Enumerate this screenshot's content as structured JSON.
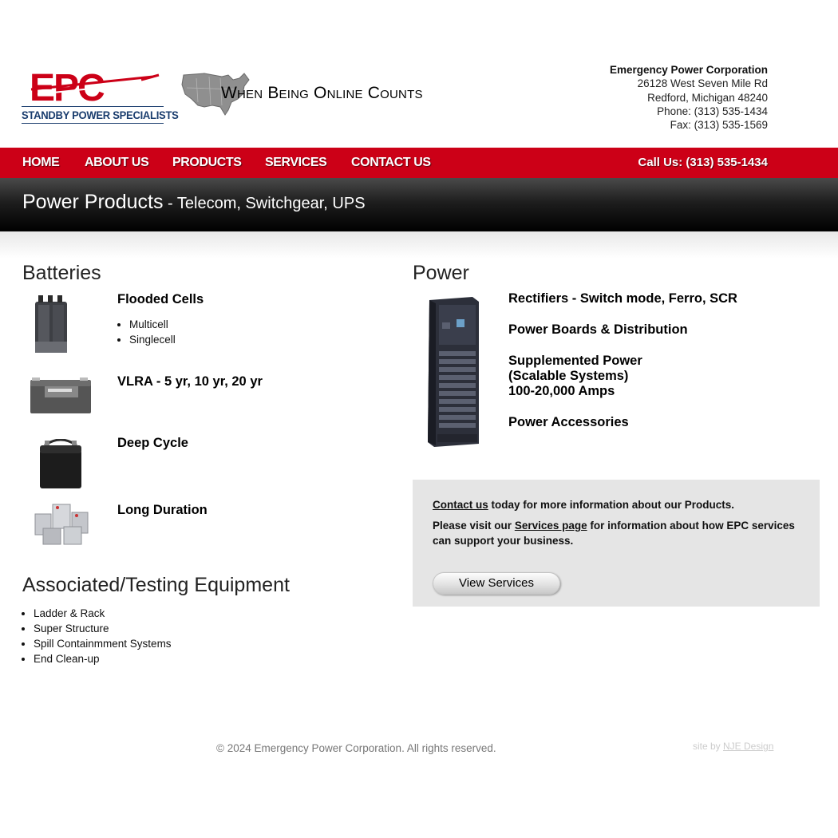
{
  "brand": {
    "logo_text": "EPC",
    "tagline": "STANDBY POWER SPECIALISTS",
    "slogan": "When Being Online Counts",
    "colors": {
      "red": "#cc0017",
      "navy": "#1a3d6e",
      "banner_dark": "#000000"
    }
  },
  "company": {
    "name": "Emergency Power Corporation",
    "street": "26128 West Seven Mile Rd",
    "city": "Redford, Michigan 48240",
    "phone": "Phone: (313) 535-1434",
    "fax": "Fax: (313) 535-1569"
  },
  "nav": {
    "items": [
      {
        "label": "HOME"
      },
      {
        "label": "ABOUT US"
      },
      {
        "label": "PRODUCTS"
      },
      {
        "label": "SERVICES"
      },
      {
        "label": "CONTACT US"
      }
    ],
    "call_us": "Call Us: (313) 535-1434"
  },
  "banner": {
    "title": "Power Products",
    "subtitle": " - Telecom, Switchgear, UPS"
  },
  "batteries": {
    "heading": "Batteries",
    "products": [
      {
        "title": "Flooded Cells",
        "bullets": [
          "Multicell",
          "Singlecell"
        ],
        "image_icon": "flooded-cell-battery-icon"
      },
      {
        "title": "VLRA - 5 yr, 10 yr, 20 yr",
        "image_icon": "vrla-battery-icon"
      },
      {
        "title": "Deep Cycle",
        "image_icon": "deep-cycle-battery-icon"
      },
      {
        "title": "Long Duration",
        "image_icon": "long-duration-battery-icon"
      }
    ]
  },
  "associated": {
    "heading": "Associated/Testing Equipment",
    "items": [
      "Ladder & Rack",
      "Super Structure",
      "Spill Containmment Systems",
      "End Clean-up"
    ]
  },
  "power": {
    "heading": "Power",
    "image_icon": "power-rack-cabinet-icon",
    "items": [
      "Rectifiers - Switch mode, Ferro, SCR",
      "Power Boards & Distribution",
      "Supplemented Power",
      "(Scalable Systems)",
      "100-20,000 Amps",
      "Power Accessories"
    ]
  },
  "info_box": {
    "contact_link": "Contact us",
    "contact_rest": " today for more information about our Products.",
    "services_pre": "Please visit our ",
    "services_link": "Services page",
    "services_rest": " for information about how EPC services can support your business.",
    "button_label": "View Services"
  },
  "footer": {
    "copyright": "© 2024 Emergency Power Corporation. All rights reserved.",
    "credit_pre": "site by ",
    "credit_link": "NJE Design"
  }
}
